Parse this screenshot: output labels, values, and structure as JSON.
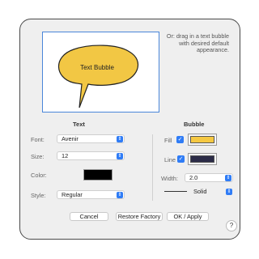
{
  "preview": {
    "bubble_text": "Text Bubble",
    "bubble_fill": "#f2c744",
    "bubble_stroke": "#222222"
  },
  "hint": {
    "text": "Or: drag in a text bubble with desired default appearance."
  },
  "text_section": {
    "title": "Text",
    "font_label": "Font:",
    "font_value": "Avenir",
    "size_label": "Size:",
    "size_value": "12",
    "color_label": "Color:",
    "color_value": "#000000",
    "style_label": "Style:",
    "style_value": "Regular"
  },
  "bubble_section": {
    "title": "Bubble",
    "fill_label": "Fill",
    "fill_checked": true,
    "fill_color": "#f5c842",
    "line_label": "Line",
    "line_checked": true,
    "line_color": "#2b2b47",
    "width_label": "Width:",
    "width_value": "2.0",
    "line_style_value": "Solid"
  },
  "buttons": {
    "cancel": "Cancel",
    "restore": "Restore Factory",
    "ok": "OK / Apply",
    "help": "?"
  },
  "icons": {
    "select_chevron": "chevron-updown-icon",
    "checkbox": "checkmark-icon"
  }
}
